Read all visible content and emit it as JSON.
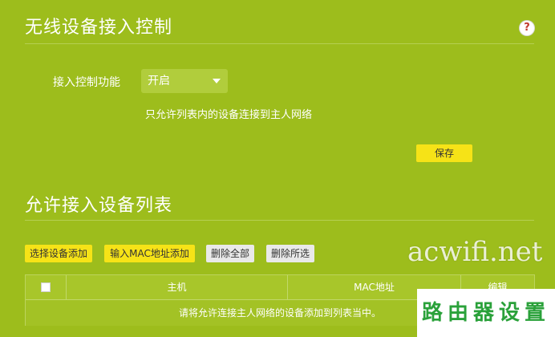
{
  "access_control": {
    "title": "无线设备接入控制",
    "help_glyph": "?",
    "function_label": "接入控制功能",
    "function_value": "开启",
    "hint": "只允许列表内的设备连接到主人网络",
    "save_label": "保存"
  },
  "device_list": {
    "title": "允许接入设备列表",
    "buttons": {
      "select_device_add": "选择设备添加",
      "input_mac_add": "输入MAC地址添加",
      "delete_all": "删除全部",
      "delete_selected": "删除所选"
    },
    "columns": [
      "主机",
      "MAC地址",
      "编辑"
    ],
    "empty_message": "请将允许连接主人网络的设备添加到列表当中。"
  },
  "watermark": "acwifi.net",
  "corner_badge": "路由器设置",
  "colors": {
    "background": "#9dbd1c",
    "button_primary": "#f6e317",
    "button_secondary": "#e9e9e9"
  }
}
